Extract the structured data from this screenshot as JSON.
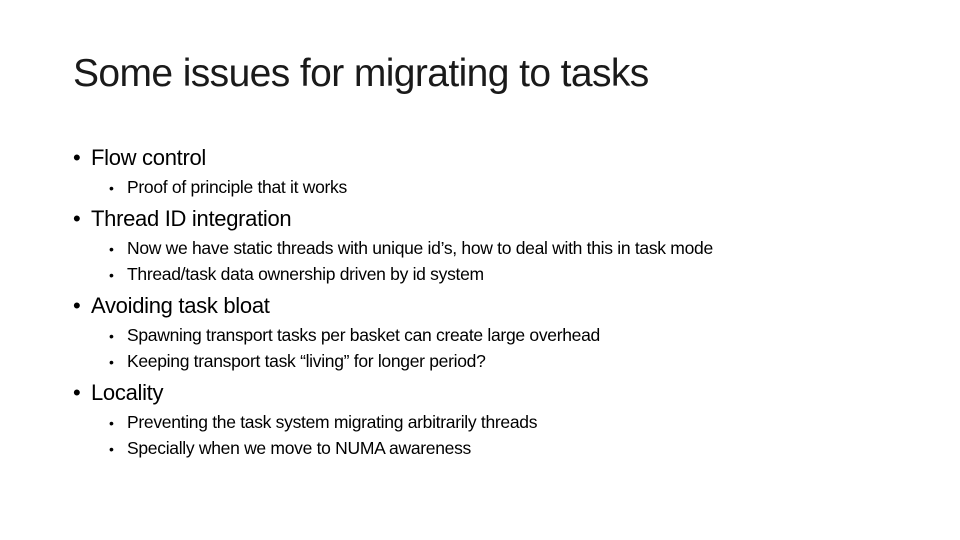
{
  "slide": {
    "title": "Some issues for migrating to tasks",
    "bullet_glyph": "•",
    "items": [
      {
        "label": "Flow control",
        "subitems": [
          "Proof of principle that it works"
        ]
      },
      {
        "label": "Thread ID integration",
        "subitems": [
          "Now we have static threads with unique id’s, how to deal with this in task mode",
          "Thread/task data ownership driven by id system"
        ]
      },
      {
        "label": "Avoiding task bloat",
        "subitems": [
          "Spawning transport tasks per basket can create large overhead",
          "Keeping transport task “living” for longer period?"
        ]
      },
      {
        "label": "Locality",
        "subitems": [
          "Preventing the task system migrating arbitrarily threads",
          "Specially when we move to NUMA awareness"
        ]
      }
    ]
  }
}
